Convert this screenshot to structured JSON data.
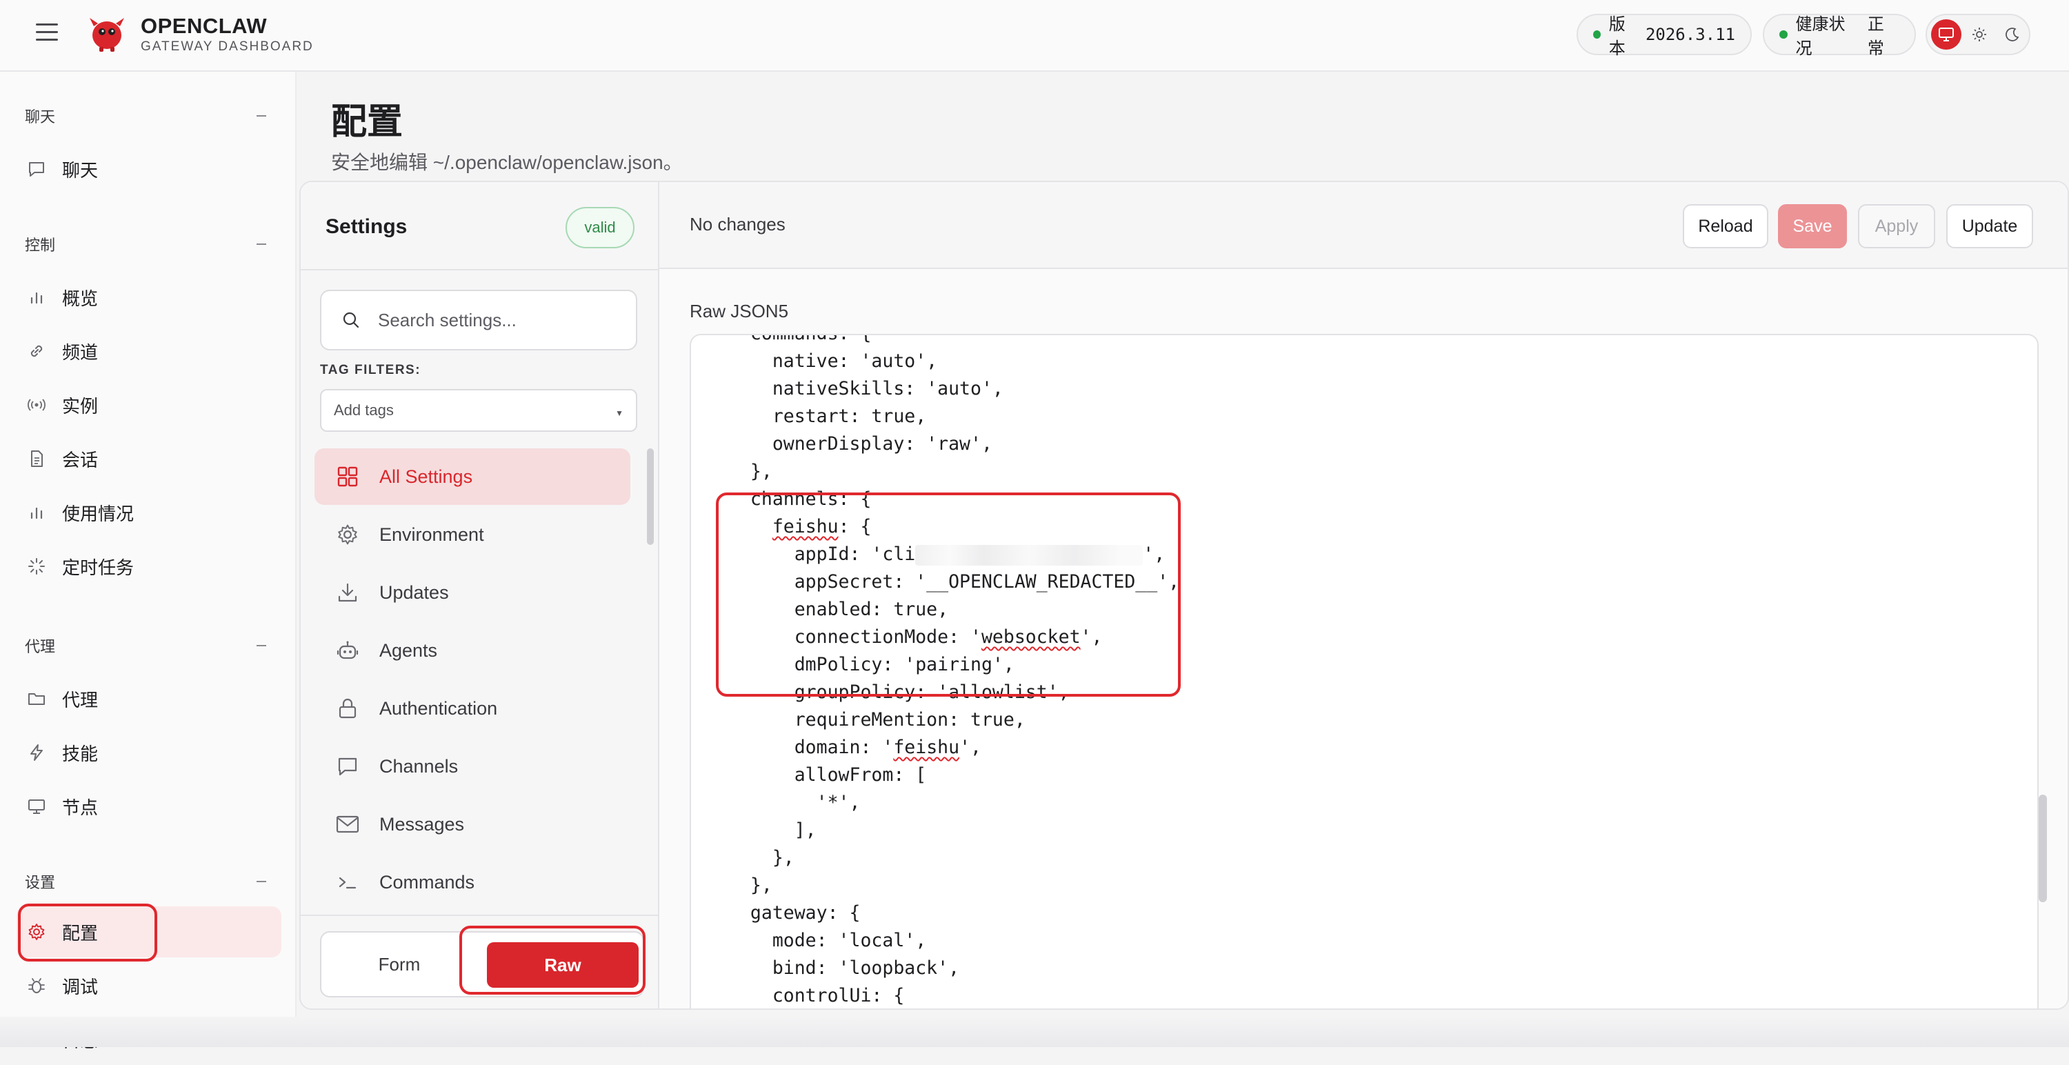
{
  "header": {
    "brand_title": "OPENCLAW",
    "brand_subtitle": "GATEWAY DASHBOARD",
    "version_label": "版本",
    "version_value": "2026.3.11",
    "health_label": "健康状况",
    "health_value": "正常",
    "status_color": "#22a447",
    "accent_color": "#d9262c"
  },
  "sidebar": {
    "sections": [
      {
        "label": "聊天",
        "items": [
          {
            "label": "聊天",
            "icon": "chat-bubble-icon"
          }
        ]
      },
      {
        "label": "控制",
        "items": [
          {
            "label": "概览",
            "icon": "bar-chart-icon"
          },
          {
            "label": "频道",
            "icon": "link-icon"
          },
          {
            "label": "实例",
            "icon": "radio-broadcast-icon"
          },
          {
            "label": "会话",
            "icon": "document-icon"
          },
          {
            "label": "使用情况",
            "icon": "bar-chart-icon"
          },
          {
            "label": "定时任务",
            "icon": "loader-icon"
          }
        ]
      },
      {
        "label": "代理",
        "items": [
          {
            "label": "代理",
            "icon": "folder-icon"
          },
          {
            "label": "技能",
            "icon": "lightning-icon"
          },
          {
            "label": "节点",
            "icon": "monitor-icon"
          }
        ]
      },
      {
        "label": "设置",
        "items": [
          {
            "label": "配置",
            "icon": "gear-icon",
            "active": true
          },
          {
            "label": "调试",
            "icon": "bug-icon"
          },
          {
            "label": "日志",
            "icon": "log-icon"
          }
        ]
      }
    ]
  },
  "page": {
    "title": "配置",
    "subtitle": "安全地编辑 ~/.openclaw/openclaw.json。"
  },
  "settings": {
    "title": "Settings",
    "valid_badge": "valid",
    "search_placeholder": "Search settings...",
    "tag_filters_label": "TAG FILTERS:",
    "tag_placeholder": "Add tags",
    "categories": [
      {
        "label": "All Settings",
        "icon": "grid-icon",
        "active": true
      },
      {
        "label": "Environment",
        "icon": "gear-icon"
      },
      {
        "label": "Updates",
        "icon": "download-icon"
      },
      {
        "label": "Agents",
        "icon": "robot-icon"
      },
      {
        "label": "Authentication",
        "icon": "lock-icon"
      },
      {
        "label": "Channels",
        "icon": "chat-bubble-icon"
      },
      {
        "label": "Messages",
        "icon": "mail-icon"
      },
      {
        "label": "Commands",
        "icon": "terminal-icon"
      }
    ],
    "mode_form": "Form",
    "mode_raw": "Raw"
  },
  "editor": {
    "status": "No changes",
    "buttons": {
      "reload": "Reload",
      "save": "Save",
      "apply": "Apply",
      "update": "Update"
    },
    "raw_label": "Raw JSON5",
    "code_lines": [
      "  commands: {",
      "    native: 'auto',",
      "    nativeSkills: 'auto',",
      "    restart: true,",
      "    ownerDisplay: 'raw',",
      "  },",
      "  channels: {",
      "    feishu: {",
      "      appId: 'cli",
      "      appSecret: '__OPENCLAW_REDACTED__',",
      "      enabled: true,",
      "      connectionMode: 'websocket',",
      "      dmPolicy: 'pairing',",
      "      groupPolicy: 'allowlist',",
      "      requireMention: true,",
      "      domain: 'feishu',",
      "      allowFrom: [",
      "        '*',",
      "      ],",
      "    },",
      "  },",
      "  gateway: {",
      "    mode: 'local',",
      "    bind: 'loopback',",
      "    controlUi: {"
    ],
    "appid_tail": "',"
  }
}
